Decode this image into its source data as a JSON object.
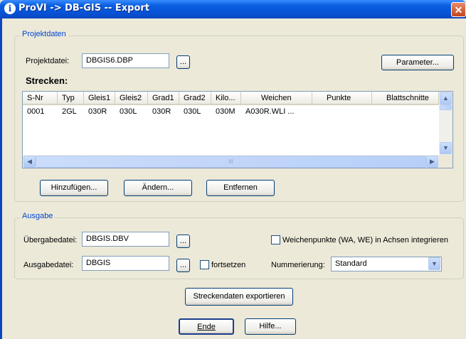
{
  "window": {
    "title": "ProVI -> DB-GIS -- Export",
    "close_glyph": "✕",
    "info_glyph": "i"
  },
  "projektdaten": {
    "group_title": "Projektdaten",
    "projektdatei_label": "Projektdatei:",
    "projektdatei_value": "DBGIS6.DBP",
    "browse_label": "...",
    "parameter_label": "Parameter...",
    "strecken_heading": "Strecken:",
    "columns": [
      "S-Nr",
      "Typ",
      "Gleis1",
      "Gleis2",
      "Grad1",
      "Grad2",
      "Kilo...",
      "Weichen",
      "Punkte",
      "Blattschnitte"
    ],
    "rows": [
      [
        "0001",
        "2GL",
        "030R",
        "030L",
        "030R",
        "030L",
        "030M",
        "A030R.WLI ...",
        "",
        ""
      ]
    ],
    "hinzufuegen_label": "Hinzufügen...",
    "aendern_label": "Ändern...",
    "entfernen_label": "Entfernen"
  },
  "ausgabe": {
    "group_title": "Ausgabe",
    "uebergabedatei_label": "Übergabedatei:",
    "uebergabedatei_value": "DBGIS.DBV",
    "ausgabedatei_label": "Ausgabedatei:",
    "ausgabedatei_value": "DBGIS",
    "browse_label": "...",
    "fortsetzen_label": "fortsetzen",
    "weichenpunkte_label": "Weichenpunkte (WA, WE) in Achsen integrieren",
    "nummerierung_label": "Nummerierung:",
    "nummerierung_value": "Standard"
  },
  "buttons": {
    "export_label": "Streckendaten exportieren",
    "ende_label": "Ende",
    "hilfe_label": "Hilfe..."
  },
  "scroll": {
    "up": "▲",
    "down": "▼",
    "left": "◀",
    "right": "▶",
    "grip": "III"
  }
}
